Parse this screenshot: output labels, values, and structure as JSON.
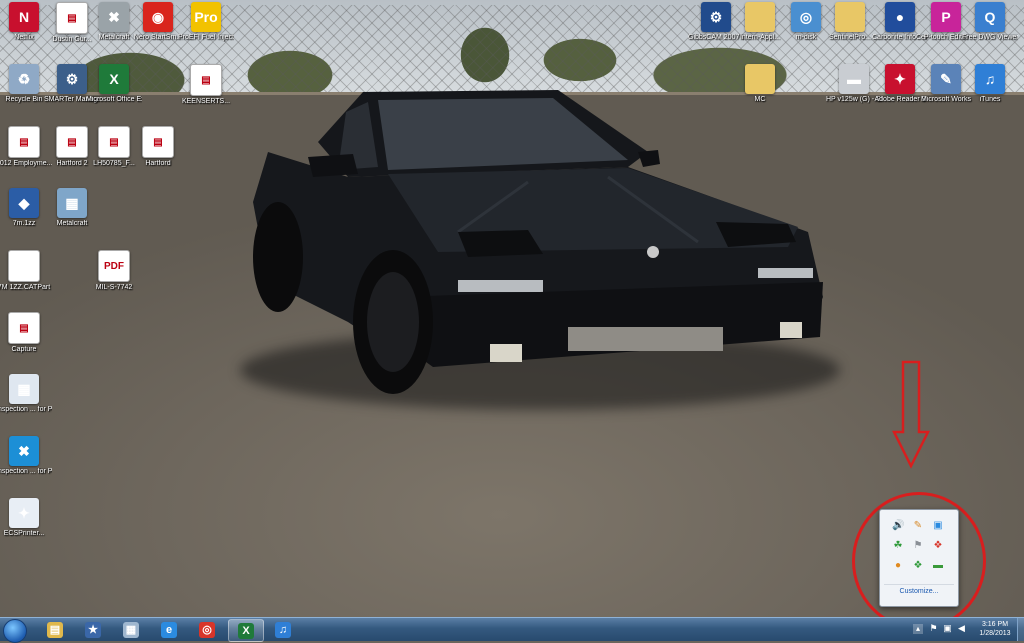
{
  "desktop": {
    "icons": [
      {
        "label": "Netflix",
        "glyph": "N",
        "color": "#c8102e",
        "icon": "netflix-icon"
      },
      {
        "label": "Dustin Gur...",
        "glyph": "▤",
        "color": "#ffffff",
        "icon": "document-icon"
      },
      {
        "label": "Metalcraft",
        "glyph": "✖",
        "color": "#9aa3a8",
        "icon": "network-drive-icon"
      },
      {
        "label": "Nero StartSm...",
        "glyph": "◉",
        "color": "#d9251d",
        "icon": "nero-icon"
      },
      {
        "label": "ProEFI Fuel Injection ...",
        "glyph": "Pro",
        "color": "#f2c200",
        "icon": "proefi-icon"
      },
      {
        "label": "Recycle Bin",
        "glyph": "♻",
        "color": "#8fa9c6",
        "icon": "recycle-bin-icon"
      },
      {
        "label": "SMARTer Manager",
        "glyph": "⚙",
        "color": "#3c5f8a",
        "icon": "smarter-manager-icon"
      },
      {
        "label": "Microsoft Office Exc...",
        "glyph": "X",
        "color": "#1f7a3a",
        "icon": "excel-icon"
      },
      {
        "label": "KEENSERTS...",
        "glyph": "▤",
        "color": "#ffffff",
        "icon": "document-icon"
      },
      {
        "label": "2012 Employme...",
        "glyph": "▤",
        "color": "#ffffff",
        "icon": "pdf-document-icon"
      },
      {
        "label": "Hartford 2",
        "glyph": "▤",
        "color": "#ffffff",
        "icon": "pdf-document-icon"
      },
      {
        "label": "LH50785_F...",
        "glyph": "▤",
        "color": "#ffffff",
        "icon": "pdf-document-icon"
      },
      {
        "label": "Hartford",
        "glyph": "▤",
        "color": "#ffffff",
        "icon": "pdf-document-icon"
      },
      {
        "label": "7m.1zz",
        "glyph": "◆",
        "color": "#2b5da6",
        "icon": "cad-file-icon"
      },
      {
        "label": "Metalcraft",
        "glyph": "▦",
        "color": "#7fa6c9",
        "icon": "spreadsheet-icon"
      },
      {
        "label": "7M 1ZZ.CATPart",
        "glyph": "",
        "color": "#ffffff",
        "icon": "blank-file-icon"
      },
      {
        "label": "MIL-S-7742",
        "glyph": "PDF",
        "color": "#ffffff",
        "icon": "pdf-file-icon"
      },
      {
        "label": "Capture",
        "glyph": "▤",
        "color": "#ffffff",
        "icon": "image-file-icon"
      },
      {
        "label": "Inspection ... for PDF 2012",
        "glyph": "▦",
        "color": "#dfe7f0",
        "icon": "inspection-app-icon"
      },
      {
        "label": "Inspection ... for PDF 2013",
        "glyph": "✖",
        "color": "#1c8fd6",
        "icon": "inspection-app-icon"
      },
      {
        "label": "ECSPrinter...",
        "glyph": "✦",
        "color": "#e8eef5",
        "icon": "printer-app-icon"
      },
      {
        "label": "GibbsCAM 2007 v8.5",
        "glyph": "⚙",
        "color": "#214b8c",
        "icon": "gibbscam-icon"
      },
      {
        "label": "Intern-Appl...",
        "glyph": "",
        "color": "#e8c766",
        "icon": "folder-icon"
      },
      {
        "label": "m-disk",
        "glyph": "◎",
        "color": "#4a8fd0",
        "icon": "m-disk-icon"
      },
      {
        "label": "SentinelPro...",
        "glyph": "",
        "color": "#e8c766",
        "icon": "folder-icon"
      },
      {
        "label": "Carbonite InfoCenter",
        "glyph": "●",
        "color": "#214d9c",
        "icon": "carbonite-icon"
      },
      {
        "label": "P-touch Editor",
        "glyph": "P",
        "color": "#c8249a",
        "icon": "ptouch-icon"
      },
      {
        "label": "Free DWG Viewer",
        "glyph": "Q",
        "color": "#3a7fcf",
        "icon": "dwg-viewer-icon"
      },
      {
        "label": "MC",
        "glyph": "",
        "color": "#e8c766",
        "icon": "folder-icon"
      },
      {
        "label": "HP v125w (G) - Shortcut",
        "glyph": "▬",
        "color": "#c9cdd2",
        "icon": "usb-drive-icon"
      },
      {
        "label": "Adobe Reader 9",
        "glyph": "✦",
        "color": "#c8102e",
        "icon": "adobe-reader-icon"
      },
      {
        "label": "Microsoft Works",
        "glyph": "✎",
        "color": "#5b83b8",
        "icon": "works-icon"
      },
      {
        "label": "iTunes",
        "glyph": "♫",
        "color": "#2f7fd6",
        "icon": "itunes-icon"
      }
    ]
  },
  "tray_popup": {
    "customize_label": "Customize...",
    "icons": [
      {
        "glyph": "🔊",
        "icon": "volume-icon"
      },
      {
        "glyph": "✎",
        "icon": "pen-icon"
      },
      {
        "glyph": "▣",
        "icon": "sync-icon"
      },
      {
        "glyph": "☘",
        "icon": "green-app-icon"
      },
      {
        "glyph": "⚑",
        "icon": "action-center-flag-icon"
      },
      {
        "glyph": "❖",
        "icon": "colorful-app-icon"
      },
      {
        "glyph": "●",
        "icon": "orange-app-icon"
      },
      {
        "glyph": "❖",
        "icon": "colorful-app-icon"
      },
      {
        "glyph": "▬",
        "icon": "nvidia-icon"
      }
    ]
  },
  "taskbar": {
    "buttons": [
      {
        "glyph": "▤",
        "color": "#e0b84c",
        "icon": "explorer-icon",
        "active": false
      },
      {
        "glyph": "★",
        "color": "#3a67a8",
        "icon": "program-icon",
        "active": false
      },
      {
        "glyph": "▦",
        "color": "#9fb7cf",
        "icon": "calculator-icon",
        "active": false
      },
      {
        "glyph": "e",
        "color": "#2b8be0",
        "icon": "internet-explorer-icon",
        "active": false
      },
      {
        "glyph": "◎",
        "color": "#d8352a",
        "icon": "chrome-icon",
        "active": false
      },
      {
        "glyph": "X",
        "color": "#1f7a3a",
        "icon": "excel-icon",
        "active": true
      },
      {
        "glyph": "♫",
        "color": "#2f7fd6",
        "icon": "itunes-icon",
        "active": false
      }
    ],
    "tray_up_glyph": "▴",
    "sys_icons": [
      {
        "glyph": "⚑",
        "icon": "flag-icon"
      },
      {
        "glyph": "▣",
        "icon": "network-icon"
      },
      {
        "glyph": "◀",
        "icon": "speaker-icon"
      }
    ],
    "clock_time": "3:16 PM",
    "clock_date": "1/28/2013"
  },
  "colors": {
    "annotation": "#d81e1e",
    "taskbar": "#34597f"
  }
}
